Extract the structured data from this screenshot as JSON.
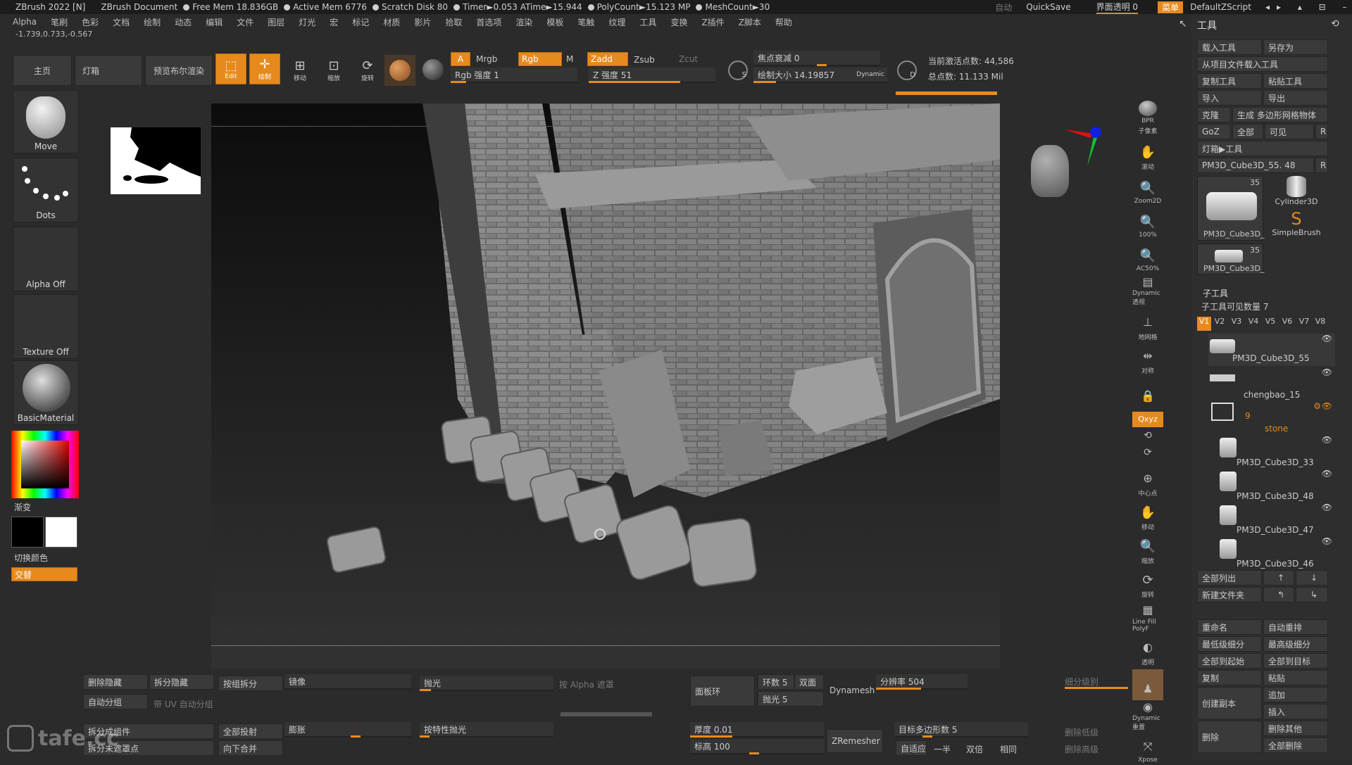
{
  "title_bar": {
    "app": "ZBrush 2022 [N]",
    "doc": "ZBrush Document",
    "stats": [
      "Free Mem 18.836GB",
      "Active Mem 6776",
      "Scratch Disk 80",
      "Timer►0.053 ATime►15.944",
      "PolyCount►15.123 MP",
      "MeshCount►30"
    ],
    "auto": "自动",
    "quicksave": "QuickSave",
    "transparency": "界面透明 0",
    "menu": "菜单",
    "script": "DefaultZScript"
  },
  "menu": [
    "Alpha",
    "笔刷",
    "色彩",
    "文档",
    "绘制",
    "动态",
    "编辑",
    "文件",
    "图层",
    "灯光",
    "宏",
    "标记",
    "材质",
    "影片",
    "拾取",
    "首选项",
    "渲染",
    "模板",
    "笔触",
    "纹理",
    "工具",
    "变换",
    "Z插件",
    "Z脚本",
    "帮助"
  ],
  "coords": "-1.739,0.733,-0.567",
  "top_shelf": {
    "home": "主页",
    "lightbox": "灯箱",
    "preview": "预览布尔渲染",
    "edit": "Edit",
    "draw": "绘制",
    "move": "移动",
    "scale": "缩放",
    "rotate": "旋转",
    "a": "A",
    "mrgb": "Mrgb",
    "rgb": "Rgb",
    "m": "M",
    "zadd": "Zadd",
    "zsub": "Zsub",
    "zcut": "Zcut",
    "rgb_intensity": "Rgb 强度 1",
    "z_intensity": "Z 强度 51",
    "focal": "焦点衰减 0",
    "draw_size": "绘制大小 14.19857",
    "dynamic": "Dynamic",
    "active_points": "当前激活点数: 44,586",
    "total_points": "总点数: 11.133 Mil"
  },
  "left_shelf": {
    "brush": "Move",
    "stroke": "Dots",
    "alpha": "Alpha Off",
    "texture": "Texture Off",
    "material": "BasicMaterial",
    "gradient": "渐变",
    "switch_color": "切换颜色",
    "alternate": "交替"
  },
  "right_strip": [
    "BPR",
    "子像素",
    "滚动",
    "Zoom2D",
    "100%",
    "AC50%",
    "Dynamic 透视",
    "地网格",
    "对称",
    "",
    "Qxyz",
    "",
    "",
    "中心点",
    "移动",
    "缩放",
    "旋转",
    "Line Fill PolyF",
    "透明",
    "Dynamic 重置",
    "Xpose"
  ],
  "tool_panel": {
    "title": "工具",
    "load": "载入工具",
    "save_as": "另存为",
    "load_project": "从项目文件载入工具",
    "copy": "复制工具",
    "paste": "粘贴工具",
    "import": "导入",
    "export": "导出",
    "clone": "克隆",
    "make_polymesh": "生成 多边形网格物体",
    "goz": "GoZ",
    "all": "全部",
    "visible": "可见",
    "r": "R",
    "lightbox_tool": "灯箱▶工具",
    "current": "PM3D_Cube3D_55. 48",
    "thumbs": [
      {
        "label": "PM3D_Cube3D_",
        "count": "35"
      },
      {
        "label": "Cylinder3D",
        "count": ""
      },
      {
        "label": "SimpleBrush",
        "count": ""
      },
      {
        "label": "PM3D_Cube3D_",
        "count": "35"
      }
    ],
    "subtool": "子工具",
    "visible_count": "子工具可见数量 7",
    "versions": [
      "V1",
      "V2",
      "V3",
      "V4",
      "V5",
      "V6",
      "V7",
      "V8"
    ],
    "subtools": [
      "PM3D_Cube3D_55",
      "chengbao_15",
      "stone",
      "PM3D_Cube3D_33",
      "PM3D_Cube3D_48",
      "PM3D_Cube3D_47",
      "PM3D_Cube3D_46"
    ],
    "folder_count": "9",
    "list_all": "全部列出",
    "new_folder": "新建文件夹",
    "rename": "重命名",
    "auto_reorder": "自动重排",
    "lowest": "最低级细分",
    "highest": "最高级细分",
    "all_start": "全部到起始",
    "all_target": "全部到目标",
    "duplicate": "复制",
    "paste2": "粘贴",
    "append": "追加",
    "create_copy": "创建副本",
    "insert": "插入",
    "delete": "删除",
    "delete_other": "删除其他",
    "delete_all": "全部删除"
  },
  "bottom": {
    "del_hidden": "删除隐藏",
    "split_hidden": "拆分隐藏",
    "group_split": "按组拆分",
    "mirror": "镜像",
    "polish": "抛光",
    "by_alpha": "按 Alpha 遮罩",
    "panel_loops": "面板环",
    "loops": "环数 5",
    "double": "双面",
    "polish5": "抛光 5",
    "dynamesh": "Dynamesh",
    "resolution": "分辨率 504",
    "subdiv": "细分级别",
    "auto_group": "自动分组",
    "uv_group": "带 UV 自动分组",
    "split_parts": "拆分成组件",
    "project_all": "全部投射",
    "inflate": "膨胀",
    "feature_polish": "按特性抛光",
    "thickness": "厚度 0.01",
    "zremesher": "ZRemesher",
    "target_poly": "目标多边形数 5",
    "del_lower": "删除低级",
    "split_unmasked": "拆分未遮罩点",
    "merge_down": "向下合并",
    "elevation": "标高 100",
    "adaptive": "自适应",
    "half": "一半",
    "double2": "双倍",
    "same": "相同",
    "del_higher": "删除高级",
    "watermark": "tafe.cc"
  },
  "colors": {
    "accent": "#e68a1e",
    "panel": "#2e2e2e",
    "bg": "#2b2b2b"
  }
}
